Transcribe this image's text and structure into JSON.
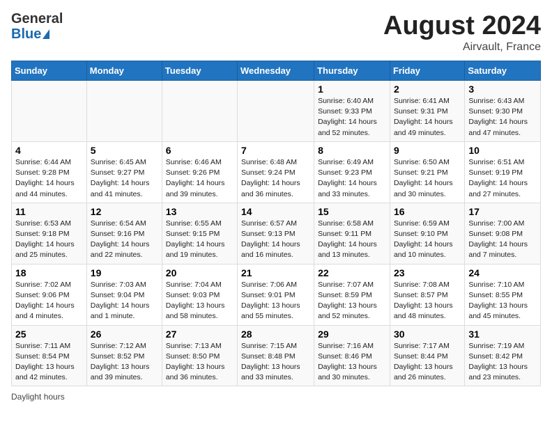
{
  "header": {
    "logo_general": "General",
    "logo_blue": "Blue",
    "month_year": "August 2024",
    "location": "Airvault, France"
  },
  "days_of_week": [
    "Sunday",
    "Monday",
    "Tuesday",
    "Wednesday",
    "Thursday",
    "Friday",
    "Saturday"
  ],
  "weeks": [
    [
      {
        "day": "",
        "info": ""
      },
      {
        "day": "",
        "info": ""
      },
      {
        "day": "",
        "info": ""
      },
      {
        "day": "",
        "info": ""
      },
      {
        "day": "1",
        "info": "Sunrise: 6:40 AM\nSunset: 9:33 PM\nDaylight: 14 hours and 52 minutes."
      },
      {
        "day": "2",
        "info": "Sunrise: 6:41 AM\nSunset: 9:31 PM\nDaylight: 14 hours and 49 minutes."
      },
      {
        "day": "3",
        "info": "Sunrise: 6:43 AM\nSunset: 9:30 PM\nDaylight: 14 hours and 47 minutes."
      }
    ],
    [
      {
        "day": "4",
        "info": "Sunrise: 6:44 AM\nSunset: 9:28 PM\nDaylight: 14 hours and 44 minutes."
      },
      {
        "day": "5",
        "info": "Sunrise: 6:45 AM\nSunset: 9:27 PM\nDaylight: 14 hours and 41 minutes."
      },
      {
        "day": "6",
        "info": "Sunrise: 6:46 AM\nSunset: 9:26 PM\nDaylight: 14 hours and 39 minutes."
      },
      {
        "day": "7",
        "info": "Sunrise: 6:48 AM\nSunset: 9:24 PM\nDaylight: 14 hours and 36 minutes."
      },
      {
        "day": "8",
        "info": "Sunrise: 6:49 AM\nSunset: 9:23 PM\nDaylight: 14 hours and 33 minutes."
      },
      {
        "day": "9",
        "info": "Sunrise: 6:50 AM\nSunset: 9:21 PM\nDaylight: 14 hours and 30 minutes."
      },
      {
        "day": "10",
        "info": "Sunrise: 6:51 AM\nSunset: 9:19 PM\nDaylight: 14 hours and 27 minutes."
      }
    ],
    [
      {
        "day": "11",
        "info": "Sunrise: 6:53 AM\nSunset: 9:18 PM\nDaylight: 14 hours and 25 minutes."
      },
      {
        "day": "12",
        "info": "Sunrise: 6:54 AM\nSunset: 9:16 PM\nDaylight: 14 hours and 22 minutes."
      },
      {
        "day": "13",
        "info": "Sunrise: 6:55 AM\nSunset: 9:15 PM\nDaylight: 14 hours and 19 minutes."
      },
      {
        "day": "14",
        "info": "Sunrise: 6:57 AM\nSunset: 9:13 PM\nDaylight: 14 hours and 16 minutes."
      },
      {
        "day": "15",
        "info": "Sunrise: 6:58 AM\nSunset: 9:11 PM\nDaylight: 14 hours and 13 minutes."
      },
      {
        "day": "16",
        "info": "Sunrise: 6:59 AM\nSunset: 9:10 PM\nDaylight: 14 hours and 10 minutes."
      },
      {
        "day": "17",
        "info": "Sunrise: 7:00 AM\nSunset: 9:08 PM\nDaylight: 14 hours and 7 minutes."
      }
    ],
    [
      {
        "day": "18",
        "info": "Sunrise: 7:02 AM\nSunset: 9:06 PM\nDaylight: 14 hours and 4 minutes."
      },
      {
        "day": "19",
        "info": "Sunrise: 7:03 AM\nSunset: 9:04 PM\nDaylight: 14 hours and 1 minute."
      },
      {
        "day": "20",
        "info": "Sunrise: 7:04 AM\nSunset: 9:03 PM\nDaylight: 13 hours and 58 minutes."
      },
      {
        "day": "21",
        "info": "Sunrise: 7:06 AM\nSunset: 9:01 PM\nDaylight: 13 hours and 55 minutes."
      },
      {
        "day": "22",
        "info": "Sunrise: 7:07 AM\nSunset: 8:59 PM\nDaylight: 13 hours and 52 minutes."
      },
      {
        "day": "23",
        "info": "Sunrise: 7:08 AM\nSunset: 8:57 PM\nDaylight: 13 hours and 48 minutes."
      },
      {
        "day": "24",
        "info": "Sunrise: 7:10 AM\nSunset: 8:55 PM\nDaylight: 13 hours and 45 minutes."
      }
    ],
    [
      {
        "day": "25",
        "info": "Sunrise: 7:11 AM\nSunset: 8:54 PM\nDaylight: 13 hours and 42 minutes."
      },
      {
        "day": "26",
        "info": "Sunrise: 7:12 AM\nSunset: 8:52 PM\nDaylight: 13 hours and 39 minutes."
      },
      {
        "day": "27",
        "info": "Sunrise: 7:13 AM\nSunset: 8:50 PM\nDaylight: 13 hours and 36 minutes."
      },
      {
        "day": "28",
        "info": "Sunrise: 7:15 AM\nSunset: 8:48 PM\nDaylight: 13 hours and 33 minutes."
      },
      {
        "day": "29",
        "info": "Sunrise: 7:16 AM\nSunset: 8:46 PM\nDaylight: 13 hours and 30 minutes."
      },
      {
        "day": "30",
        "info": "Sunrise: 7:17 AM\nSunset: 8:44 PM\nDaylight: 13 hours and 26 minutes."
      },
      {
        "day": "31",
        "info": "Sunrise: 7:19 AM\nSunset: 8:42 PM\nDaylight: 13 hours and 23 minutes."
      }
    ]
  ],
  "legend": "Daylight hours"
}
